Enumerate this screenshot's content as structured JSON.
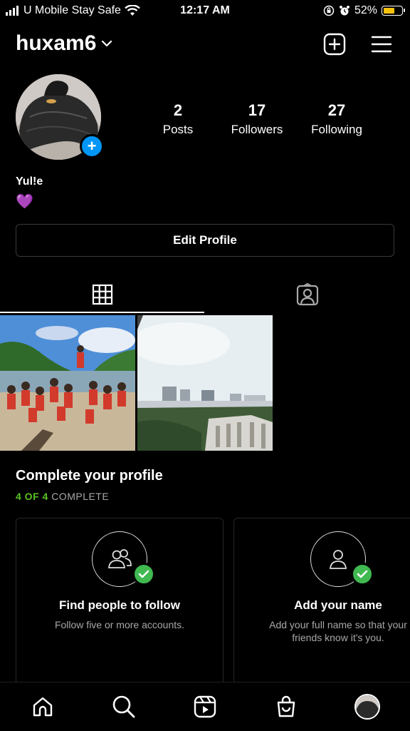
{
  "status_bar": {
    "carrier": "U Mobile Stay Safe",
    "time": "12:17 AM",
    "battery": "52%",
    "battery_level": 0.52,
    "icons": [
      "signal-icon",
      "wifi-icon",
      "orientation-lock-icon",
      "alarm-icon",
      "battery-icon"
    ]
  },
  "header": {
    "username": "huxam6",
    "icons": [
      "chevron-down-icon",
      "new-post-icon",
      "menu-icon"
    ]
  },
  "profile": {
    "stats": [
      {
        "value": "2",
        "label": "Posts"
      },
      {
        "value": "17",
        "label": "Followers"
      },
      {
        "value": "27",
        "label": "Following"
      }
    ],
    "display_name": "Yul!e",
    "bio_emoji": "💜",
    "add_story_symbol": "+"
  },
  "edit_profile_label": "Edit Profile",
  "tabs": [
    {
      "icon": "grid-icon",
      "active": true
    },
    {
      "icon": "tagged-icon",
      "active": false
    }
  ],
  "complete_profile": {
    "title": "Complete your profile",
    "progress": "4 OF 4",
    "progress_suffix": "COMPLETE",
    "cards": [
      {
        "icon": "people-icon",
        "title": "Find people to follow",
        "desc": "Follow five or more accounts."
      },
      {
        "icon": "person-icon",
        "title": "Add your name",
        "desc": "Add your full name so that your friends know it's you."
      }
    ]
  },
  "bottom_nav": [
    "home-icon",
    "search-icon",
    "reels-icon",
    "shop-icon",
    "profile-avatar"
  ],
  "colors": {
    "accent_blue": "#0095f6",
    "complete_green": "#58c322",
    "heart_purple": "#a855f7"
  }
}
